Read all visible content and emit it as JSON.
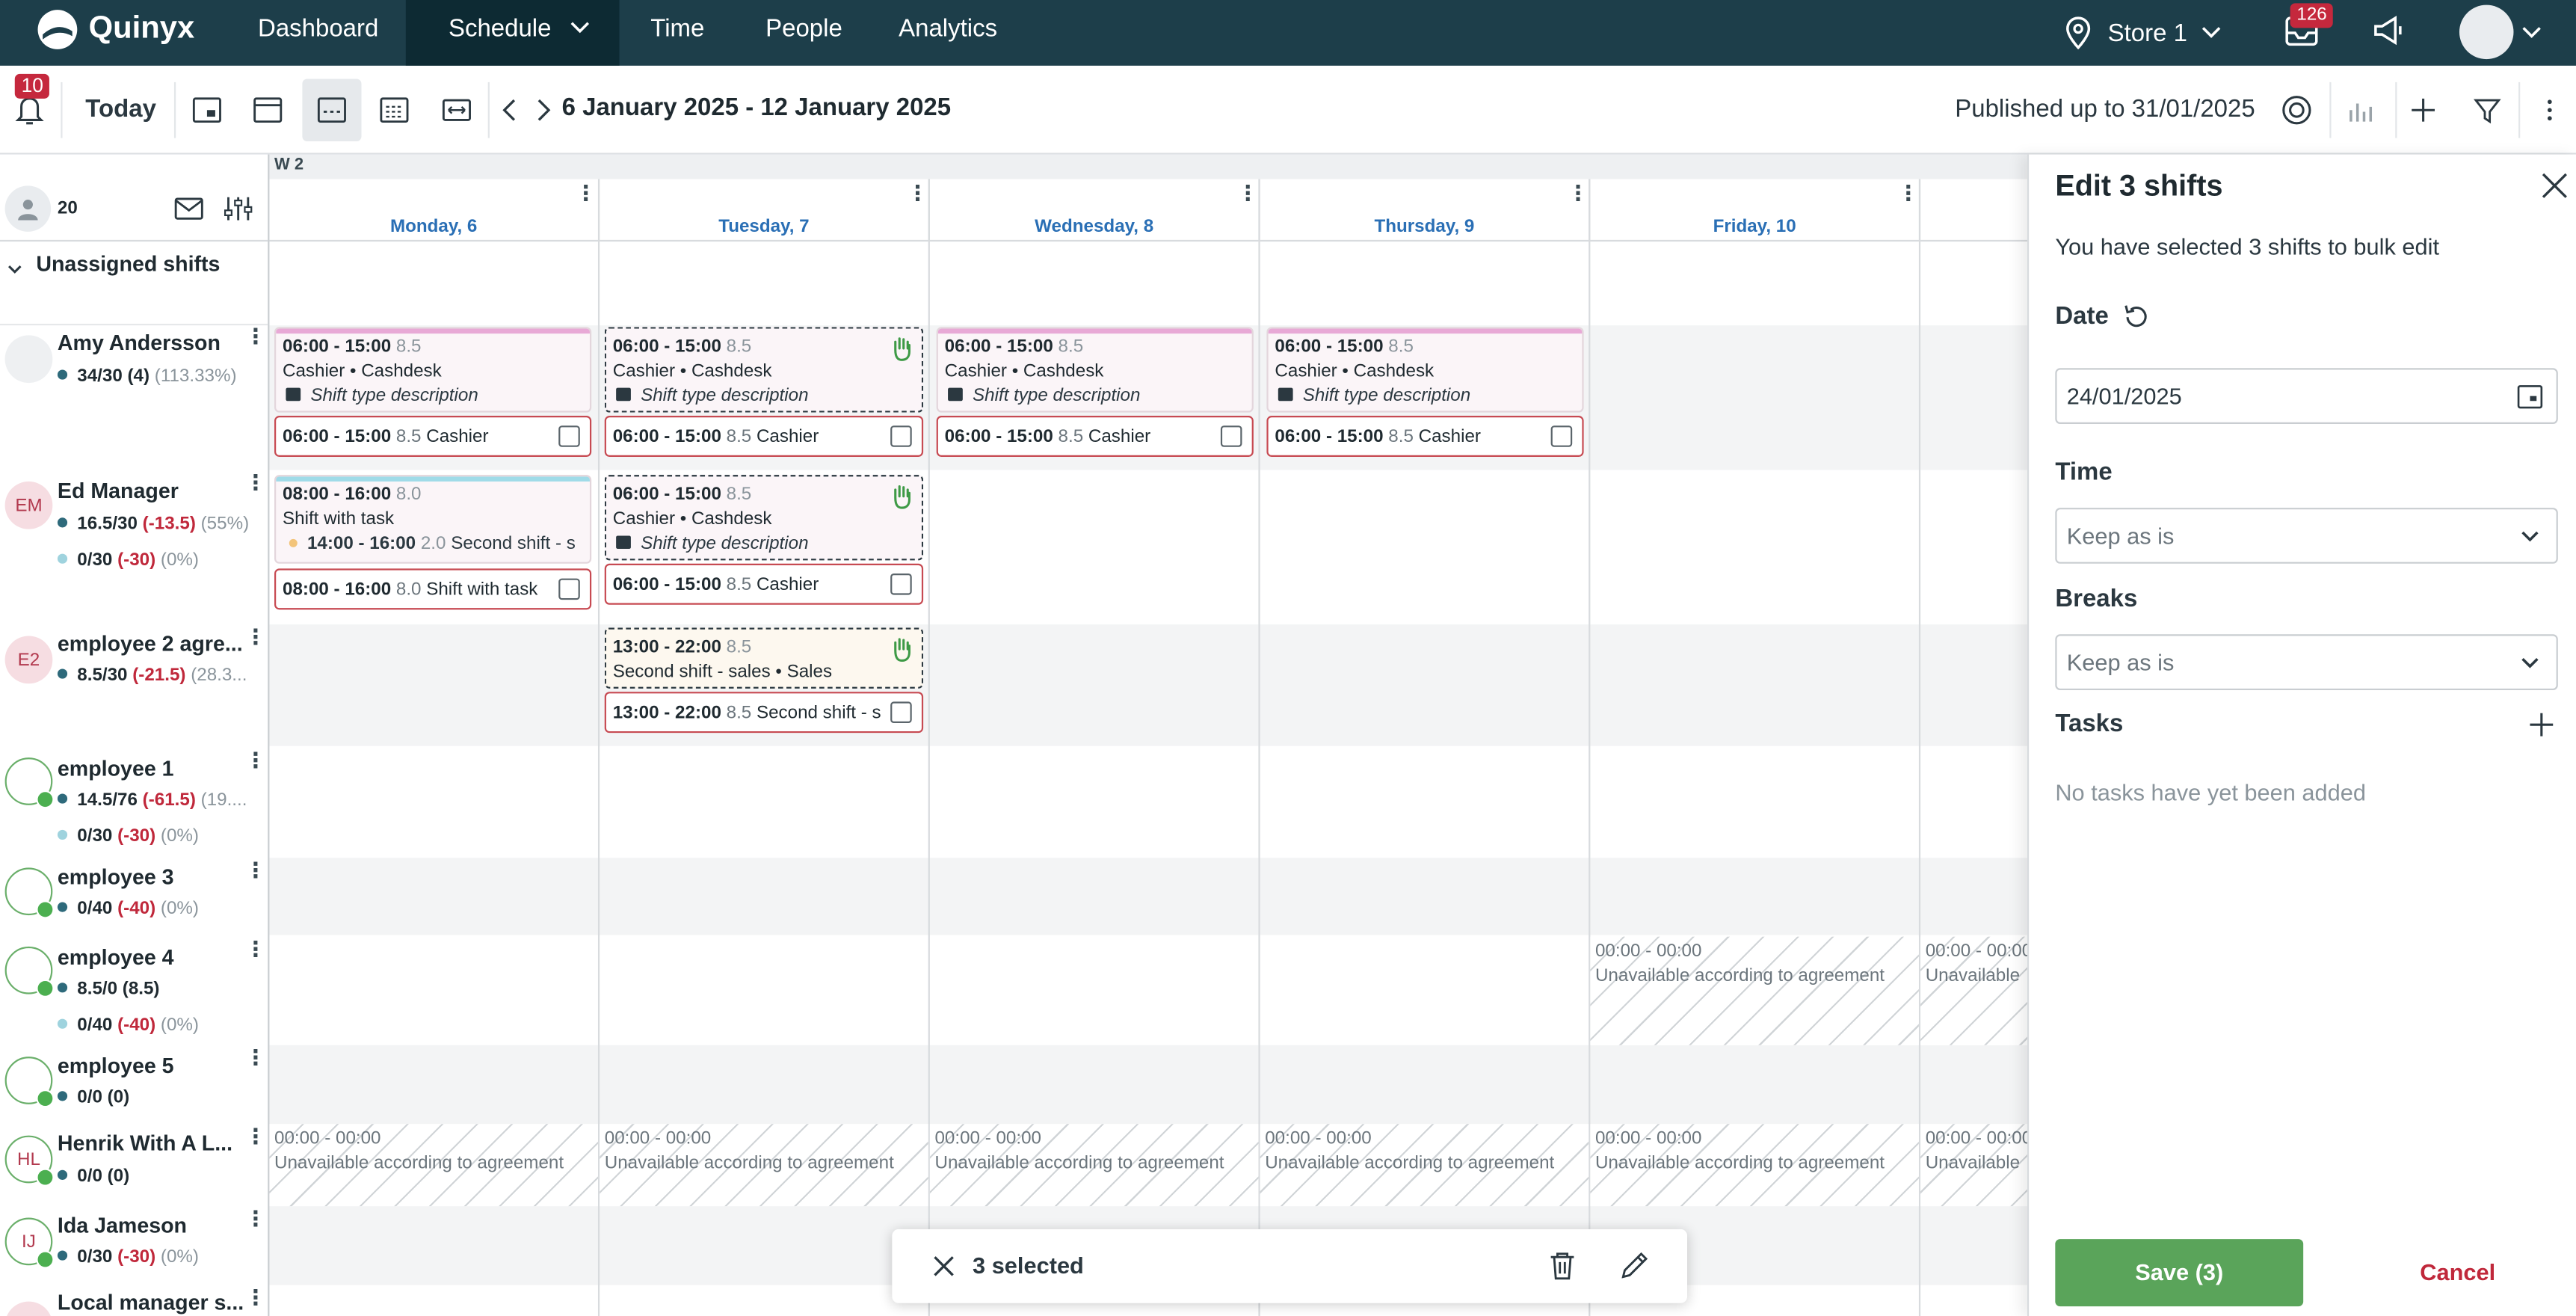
{
  "nav": {
    "brand": "Quinyx",
    "items": [
      "Dashboard",
      "Schedule",
      "Time",
      "People",
      "Analytics"
    ],
    "store": "Store 1",
    "notifications_count": "126"
  },
  "toolbar": {
    "alerts_count": "10",
    "today_label": "Today",
    "date_range": "6 January 2025 - 12 January 2025",
    "published": "Published up to 31/01/2025"
  },
  "grid": {
    "week_label": "W 2",
    "employee_count": "20",
    "unassigned_label": "Unassigned shifts",
    "days": [
      "Monday, 6",
      "Tuesday, 7",
      "Wednesday, 8",
      "Thursday, 9",
      "Friday, 10"
    ]
  },
  "employees": [
    {
      "initials": "",
      "name": "Amy Andersson",
      "stat1": {
        "main": "34/30 (4)",
        "neg": "",
        "pct": "(113.33%)"
      }
    },
    {
      "initials": "EM",
      "name": "Ed Manager",
      "stat1": {
        "main": "16.5/30",
        "neg": "(-13.5)",
        "pct": "(55%)"
      },
      "stat2": {
        "main": "0/30",
        "neg": "(-30)",
        "pct": "(0%)"
      }
    },
    {
      "initials": "E2",
      "name": "employee 2 agre...",
      "stat1": {
        "main": "8.5/30",
        "neg": "(-21.5)",
        "pct": "(28.3..."
      }
    },
    {
      "initials": "",
      "name": "employee 1",
      "stat1": {
        "main": "14.5/76",
        "neg": "(-61.5)",
        "pct": "(19...."
      },
      "stat2": {
        "main": "0/30",
        "neg": "(-30)",
        "pct": "(0%)"
      }
    },
    {
      "initials": "",
      "name": "employee 3",
      "stat1": {
        "main": "0/40",
        "neg": "(-40)",
        "pct": "(0%)"
      }
    },
    {
      "initials": "",
      "name": "employee 4",
      "stat1": {
        "main": "8.5/0 (8.5)",
        "neg": "",
        "pct": ""
      },
      "stat2": {
        "main": "0/40",
        "neg": "(-40)",
        "pct": "(0%)"
      }
    },
    {
      "initials": "",
      "name": "employee 5",
      "stat1": {
        "main": "0/0 (0)",
        "neg": "",
        "pct": ""
      }
    },
    {
      "initials": "HL",
      "name": "Henrik With A L...",
      "stat1": {
        "main": "0/0 (0)",
        "neg": "",
        "pct": ""
      }
    },
    {
      "initials": "IJ",
      "name": "Ida Jameson",
      "stat1": {
        "main": "0/30",
        "neg": "(-30)",
        "pct": "(0%)"
      }
    },
    {
      "initials": "",
      "name": "Local manager s...",
      "stat1": {
        "main": "",
        "neg": "",
        "pct": ""
      }
    }
  ],
  "shifts": {
    "time_a": "06:00 - 15:00",
    "hours_a": "8.5",
    "role_a": "Cashier • Cashdesk",
    "desc": "Shift type description",
    "prev_label_a": "Cashier",
    "time_b": "08:00 - 16:00",
    "hours_b": "8.0",
    "role_b": "Shift with task",
    "task_time": "14:00 - 16:00",
    "task_hours": "2.0",
    "task_label": "Second shift - s",
    "prev_label_b": "Shift with task",
    "time_c": "13:00 - 22:00",
    "role_c": "Second shift - sales • Sales",
    "prev_label_c": "Second shift - s"
  },
  "unavailable": {
    "time": "00:00 - 00:00",
    "label": "Unavailable according to agreement",
    "label_short": "Unavailable"
  },
  "panel": {
    "title": "Edit 3 shifts",
    "subtitle": "You have selected 3 shifts to bulk edit",
    "date_label": "Date",
    "date_value": "24/01/2025",
    "time_label": "Time",
    "time_value": "Keep as is",
    "breaks_label": "Breaks",
    "breaks_value": "Keep as is",
    "tasks_label": "Tasks",
    "tasks_empty": "No tasks have yet been added",
    "save_label": "Save (3)",
    "cancel_label": "Cancel"
  },
  "selection_bar": {
    "text": "3 selected"
  },
  "colors": {
    "nav": "#1d3e4a",
    "accent": "#2a6fb5",
    "save": "#5aa45a",
    "danger": "#c0283b",
    "shift_pink": "#e8a9d6",
    "shift_blue": "#9fdbe8",
    "shift_orange": "#f3c47a"
  }
}
